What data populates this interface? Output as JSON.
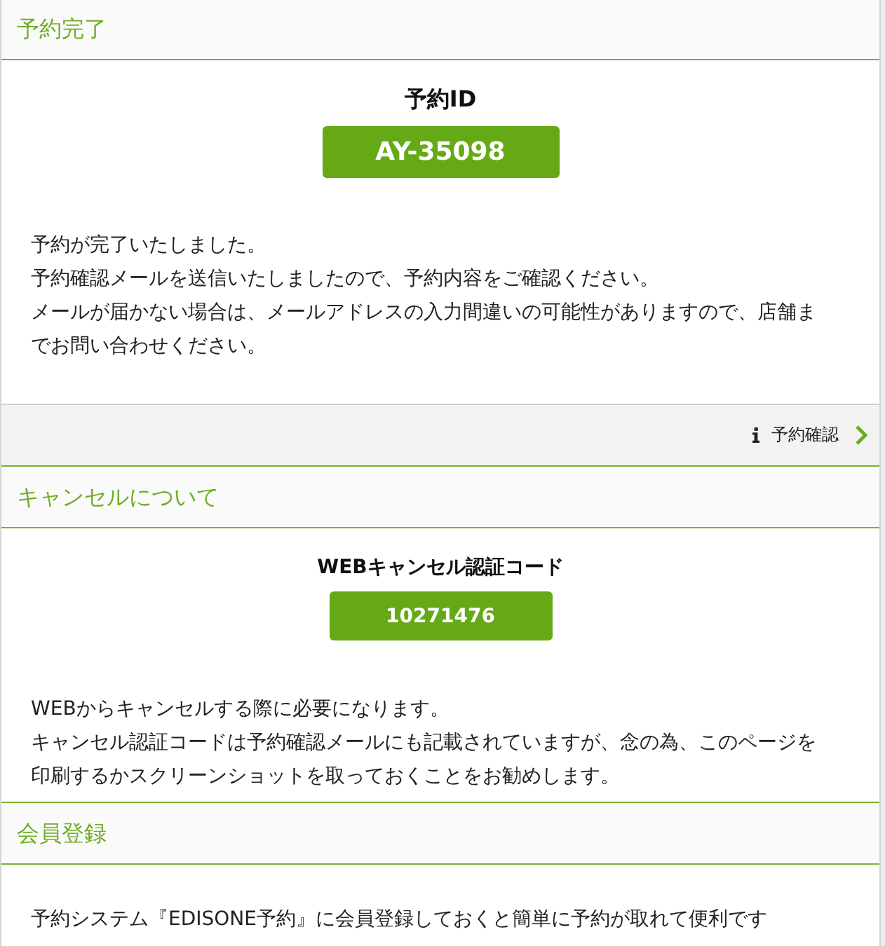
{
  "reservation_complete": {
    "title": "予約完了",
    "code_label": "予約ID",
    "code": "AY-35098",
    "paragraphs": [
      "予約が完了いたしました。",
      "予約確認メールを送信いたしましたので、予約内容をご確認ください。",
      "メールが届かない場合は、メールアドレスの入力間違いの可能性がありますので、店舗までお問い合わせください。"
    ],
    "link": {
      "label": "予約確認"
    }
  },
  "cancellation": {
    "title": "キャンセルについて",
    "code_label": "WEBキャンセル認証コード",
    "code": "10271476",
    "paragraphs": [
      "WEBからキャンセルする際に必要になります。",
      "キャンセル認証コードは予約確認メールにも記載されていますが、念の為、このページを印刷するかスクリーンショットを取っておくことをお勧めします。"
    ]
  },
  "membership": {
    "title": "会員登録",
    "paragraphs": [
      "予約システム『EDISONE予約』に会員登録しておくと簡単に予約が取れて便利です"
    ]
  }
}
